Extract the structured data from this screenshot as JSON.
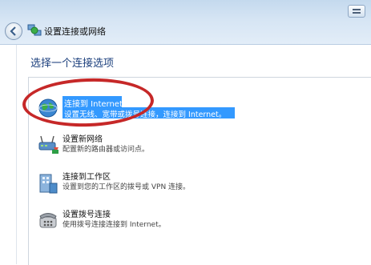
{
  "window": {
    "title": "设置连接或网络"
  },
  "main": {
    "heading": "选择一个连接选项",
    "options": [
      {
        "title": "连接到 Internet",
        "desc": "设置无线、宽带或拨号连接，连接到 Internet。",
        "selected": true,
        "icon": "globe-network-icon"
      },
      {
        "title": "设置新网络",
        "desc": "配置新的路由器或访问点。",
        "selected": false,
        "icon": "router-icon"
      },
      {
        "title": "连接到工作区",
        "desc": "设置到您的工作区的拨号或 VPN 连接。",
        "selected": false,
        "icon": "workplace-icon"
      },
      {
        "title": "设置拨号连接",
        "desc": "使用拨号连接连接到 Internet。",
        "selected": false,
        "icon": "dialup-phone-icon"
      }
    ]
  },
  "colors": {
    "selection": "#3399ff",
    "annotation_circle": "#c62828",
    "heading": "#1a3e7c"
  }
}
